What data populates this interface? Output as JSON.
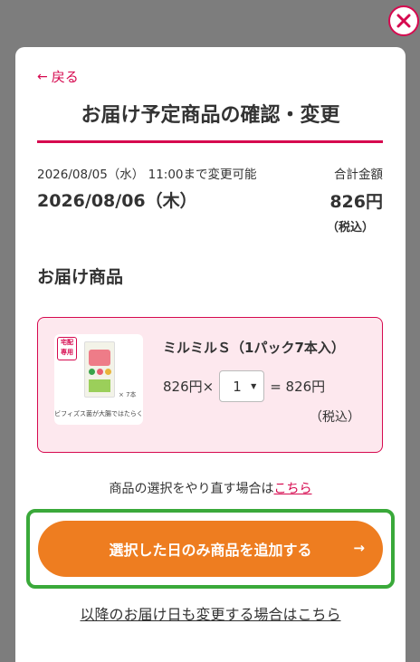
{
  "modal": {
    "back_label": "戻る",
    "title": "お届け予定商品の確認・変更"
  },
  "order": {
    "change_deadline": "2026/08/05（水） 11:00まで変更可能",
    "delivery_date": "2026/08/06（木）",
    "total_label": "合計金額",
    "total_amount": "826円",
    "total_tax_note": "（税込）"
  },
  "items_section": {
    "heading": "お届け商品",
    "items": [
      {
        "badge": "宅配専用",
        "image_caption": "ビフィズス菌が大腸ではたらく",
        "pack_count_mark": "× 7本",
        "name": "ミルミルＳ（1パック7本入）",
        "unit_price": "826円",
        "times": "×",
        "quantity": "1",
        "line_total": "= 826円",
        "tax_note": "（税込）"
      }
    ]
  },
  "reselect": {
    "text": "商品の選択をやり直す場合は",
    "link": "こちら"
  },
  "actions": {
    "primary_label": "選択した日のみ商品を追加する",
    "primary_arrow": "→",
    "secondary_label": "以降のお届け日も変更する場合はこちら"
  },
  "colors": {
    "accent": "#d6094f",
    "cta": "#ee7d20",
    "highlight": "#3aa93a",
    "card_bg": "#fde8ee"
  }
}
